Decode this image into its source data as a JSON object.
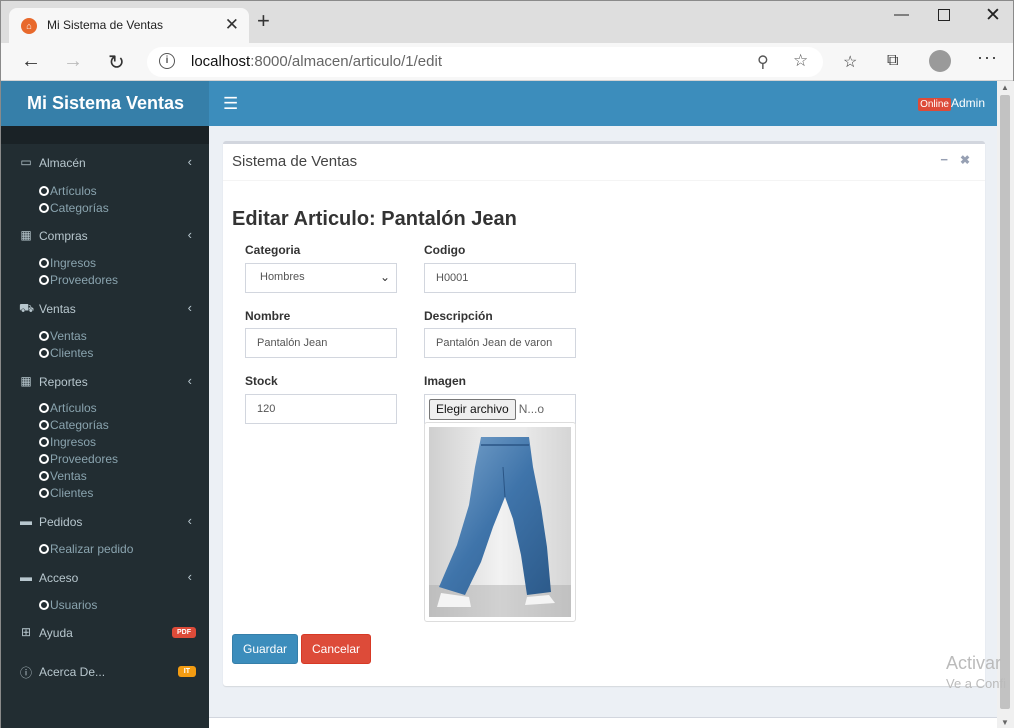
{
  "browser": {
    "tab_title": "Mi Sistema de Ventas",
    "tab_close": "✕",
    "new_tab": "+",
    "url_host": "localhost",
    "url_path": ":8000/almacen/articulo/1/edit"
  },
  "header": {
    "logo": "Mi Sistema Ventas",
    "online_badge": "Online",
    "user": "Admin"
  },
  "sidebar": {
    "almacen": {
      "label": "Almacén",
      "items": [
        "Artículos",
        "Categorías"
      ]
    },
    "compras": {
      "label": "Compras",
      "items": [
        "Ingresos",
        "Proveedores"
      ]
    },
    "ventas": {
      "label": "Ventas",
      "items": [
        "Ventas",
        "Clientes"
      ]
    },
    "reportes": {
      "label": "Reportes",
      "items": [
        "Artículos",
        "Categorías",
        "Ingresos",
        "Proveedores",
        "Ventas",
        "Clientes"
      ]
    },
    "pedidos": {
      "label": "Pedidos",
      "items": [
        "Realizar pedido"
      ]
    },
    "acceso": {
      "label": "Acceso",
      "items": [
        "Usuarios"
      ]
    },
    "ayuda": {
      "label": "Ayuda",
      "badge": "PDF"
    },
    "acerca": {
      "label": "Acerca De...",
      "badge": "IT"
    }
  },
  "box": {
    "title": "Sistema de Ventas",
    "heading": "Editar Articulo: Pantalón Jean"
  },
  "form": {
    "categoria": {
      "label": "Categoria",
      "value": "Hombres"
    },
    "codigo": {
      "label": "Codigo",
      "value": "H0001"
    },
    "nombre": {
      "label": "Nombre",
      "value": "Pantalón Jean"
    },
    "descripcion": {
      "label": "Descripción",
      "value": "Pantalón Jean de varon"
    },
    "stock": {
      "label": "Stock",
      "value": "120"
    },
    "imagen": {
      "label": "Imagen",
      "button": "Elegir archivo",
      "file_name": "N...o"
    }
  },
  "buttons": {
    "save": "Guardar",
    "cancel": "Cancelar"
  },
  "watermark": {
    "line1": "Activar",
    "line2": "Ve a Confi"
  },
  "colors": {
    "navbar": "#3c8dbc",
    "logo_bg": "#367fa9",
    "sidebar_bg": "#222d32",
    "btn_primary": "#3c8dbc",
    "btn_danger": "#dd4b39"
  }
}
